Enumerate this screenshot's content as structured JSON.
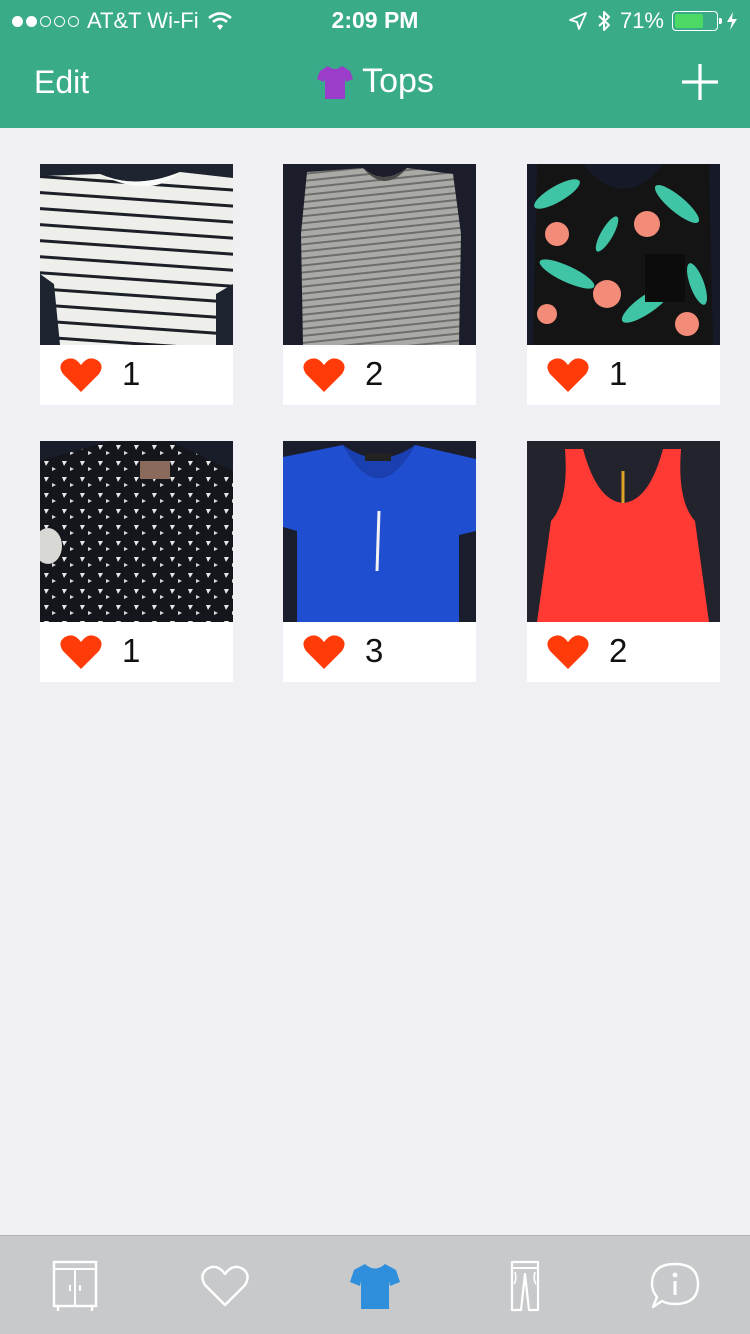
{
  "status": {
    "carrier": "AT&T Wi-Fi",
    "time": "2:09 PM",
    "battery": "71%",
    "battery_level": 0.71,
    "signal_bars": 2
  },
  "nav": {
    "edit_label": "Edit",
    "title": "Tops"
  },
  "items": [
    {
      "id": "white-striped-tee",
      "likes": "1"
    },
    {
      "id": "gray-striped-tank",
      "likes": "2"
    },
    {
      "id": "floral-tank",
      "likes": "1"
    },
    {
      "id": "black-print-shirt",
      "likes": "1"
    },
    {
      "id": "blue-blouse",
      "likes": "3"
    },
    {
      "id": "red-racerback",
      "likes": "2"
    }
  ],
  "tabs": [
    {
      "icon": "wardrobe-icon",
      "selected": false
    },
    {
      "icon": "heart-outline-icon",
      "selected": false
    },
    {
      "icon": "tshirt-icon",
      "selected": true
    },
    {
      "icon": "pants-icon",
      "selected": false
    },
    {
      "icon": "info-bubble-icon",
      "selected": false
    }
  ],
  "colors": {
    "nav_green": "#3aab89",
    "heart_red": "#ff3b0a",
    "tab_selected": "#2f8fdc",
    "tab_unselected": "#ffffff"
  }
}
